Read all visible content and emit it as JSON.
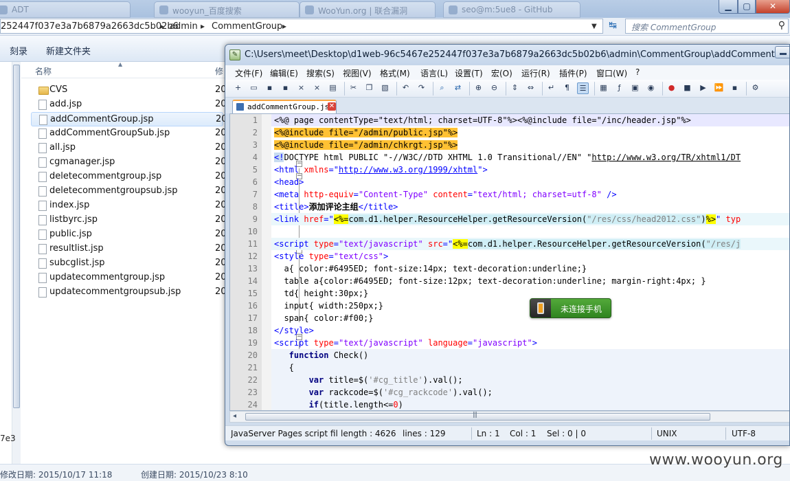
{
  "explorer": {
    "tabs": [
      "ADT",
      "wooyun_百度搜索",
      "WooYun.org | 联合漏洞",
      "seo@m:5ue8 - GitHub"
    ],
    "window_controls": {
      "minimize": "▁",
      "maximize": "▢",
      "close": "✕"
    },
    "breadcrumb": [
      "252447f037e3a7b6879a2663dc5b02b6",
      "admin",
      "CommentGroup"
    ],
    "search_placeholder": "搜索 CommentGroup",
    "toolbar": [
      "刻录",
      "新建文件夹"
    ],
    "columns": {
      "name": "名称",
      "modified": "修"
    },
    "nav_truncated": "7e3",
    "files": [
      {
        "name": "CVS",
        "modified": "20",
        "type": "folder",
        "selected": false
      },
      {
        "name": "add.jsp",
        "modified": "20",
        "type": "file",
        "selected": false
      },
      {
        "name": "addCommentGroup.jsp",
        "modified": "20",
        "type": "file",
        "selected": true
      },
      {
        "name": "addCommentGroupSub.jsp",
        "modified": "20",
        "type": "file",
        "selected": false
      },
      {
        "name": "all.jsp",
        "modified": "20",
        "type": "file",
        "selected": false
      },
      {
        "name": "cgmanager.jsp",
        "modified": "20",
        "type": "file",
        "selected": false
      },
      {
        "name": "deletecommentgroup.jsp",
        "modified": "20",
        "type": "file",
        "selected": false
      },
      {
        "name": "deletecommentgroupsub.jsp",
        "modified": "20",
        "type": "file",
        "selected": false
      },
      {
        "name": "index.jsp",
        "modified": "20",
        "type": "file",
        "selected": false
      },
      {
        "name": "listbyrc.jsp",
        "modified": "20",
        "type": "file",
        "selected": false
      },
      {
        "name": "public.jsp",
        "modified": "20",
        "type": "file",
        "selected": false
      },
      {
        "name": "resultlist.jsp",
        "modified": "20",
        "type": "file",
        "selected": false
      },
      {
        "name": "subcglist.jsp",
        "modified": "20",
        "type": "file",
        "selected": false
      },
      {
        "name": "updatecommentgroup.jsp",
        "modified": "20",
        "type": "file",
        "selected": false
      },
      {
        "name": "updatecommentgroupsub.jsp",
        "modified": "20",
        "type": "file",
        "selected": false
      }
    ],
    "status": {
      "modified": "修改日期: 2015/10/17 11:18",
      "created": "创建日期: 2015/10/23 8:10"
    }
  },
  "npp": {
    "title": "C:\\Users\\meet\\Desktop\\d1web-96c5467e252447f037e3a7b6879a2663dc5b02b6\\admin\\CommentGroup\\addCommentGroup.jsp - ...",
    "menu": [
      "文件(F)",
      "编辑(E)",
      "搜索(S)",
      "视图(V)",
      "格式(M)",
      "语言(L)",
      "设置(T)",
      "宏(O)",
      "运行(R)",
      "插件(P)",
      "窗口(W)",
      "?"
    ],
    "tab_label": "addCommentGroup.jsp",
    "line_numbers": [
      "1",
      "2",
      "3",
      "4",
      "5",
      "6",
      "7",
      "8",
      "9",
      "10",
      "11",
      "12",
      "13",
      "14",
      "15",
      "16",
      "17",
      "18",
      "19",
      "20",
      "21",
      "22",
      "23",
      "24"
    ],
    "code": {
      "l1": "<%@ page contentType=\"text/html; charset=UTF-8\"%><%@include file=\"/inc/header.jsp\"%>",
      "l2": "<%@include file=\"/admin/public.jsp\"%>",
      "l3": "<%@include file=\"/admin/chkrgt.jsp\"%>",
      "l4a": "<!",
      "l4b": "DOCTYPE html PUBLIC \"-//W3C//DTD XHTML 1.0 Transitional//EN\" \"",
      "l4c": "http://www.w3.org/TR/xhtml1/DT",
      "l5a": "<html ",
      "l5b": "xmlns",
      "l5c": "=\"",
      "l5d": "http://www.w3.org/1999/xhtml",
      "l5e": "\">",
      "l6": "<head>",
      "l7a": "<meta ",
      "l7b": "http-equiv",
      "l7c": "=",
      "l7d": "\"Content-Type\"",
      "l7e": " content",
      "l7f": "=",
      "l7g": "\"text/html; charset=utf-8\"",
      "l7h": " />",
      "l8a": "<title>",
      "l8b": "添加评论主组",
      "l8c": "</title>",
      "l9a": "<link ",
      "l9b": "href",
      "l9c": "=\"",
      "l9d": "<%=",
      "l9e": "com.d1.helper.ResourceHelper.getResourceVersion(",
      "l9f": "\"/res/css/head2012.css\"",
      "l9g": ")",
      "l9h": "%>",
      "l9i": "\" ",
      "l9j": "typ",
      "l11a": "<script ",
      "l11b": "type",
      "l11c": "=",
      "l11d": "\"text/javascript\"",
      "l11e": " src",
      "l11f": "=\"",
      "l11g": "<%=",
      "l11h": "com.d1.helper.ResourceHelper.getResourceVersion(",
      "l11i": "\"/res/j",
      "l12a": "<style ",
      "l12b": "type",
      "l12c": "=",
      "l12d": "\"text/css\"",
      "l12e": ">",
      "l13": "  a{ color:#6495ED; font-size:14px; text-decoration:underline;}",
      "l14": "  table a{color:#6495ED; font-size:12px; text-decoration:underline; margin-right:4px; }",
      "l15": "  td{ height:30px;}",
      "l16": "  input{ width:250px;}",
      "l17": "  span{ color:#f00;}",
      "l18": "</style>",
      "l19a": "<script ",
      "l19b": "type",
      "l19c": "=",
      "l19d": "\"text/javascript\"",
      "l19e": " language",
      "l19f": "=",
      "l19g": "\"javascript\"",
      "l19h": ">",
      "l20a": "   function",
      "l20b": " Check()",
      "l21": "   {",
      "l22a": "       var",
      "l22b": " title=$(",
      "l22c": "'#cg_title'",
      "l22d": ").val();",
      "l23a": "       var",
      "l23b": " rackcode=$(",
      "l23c": "'#cg_rackcode'",
      "l23d": ").val();",
      "l24a": "       if",
      "l24b": "(title.length<=",
      "l24c": "0",
      "l24d": ")"
    },
    "status": {
      "lang": "JavaServer Pages script file",
      "length": "length : 4626",
      "lines": "lines : 129",
      "ln": "Ln : 1",
      "col": "Col : 1",
      "sel": "Sel : 0 | 0",
      "eol": "UNIX",
      "enc": "UTF-8"
    }
  },
  "phone_widget": {
    "label": "未连接手机"
  },
  "watermark": "www.wooyun.org"
}
